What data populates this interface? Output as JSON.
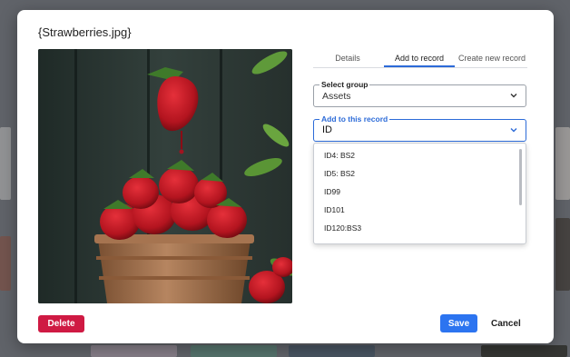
{
  "dialog": {
    "title": "{Strawberries.jpg}",
    "image_alt": "Strawberries in a paper cup"
  },
  "tabs": [
    {
      "label": "Details"
    },
    {
      "label": "Add to record",
      "active": true
    },
    {
      "label": "Create new record"
    }
  ],
  "select_group": {
    "label": "Select group",
    "value": "Assets"
  },
  "add_to_record": {
    "label": "Add to this record",
    "value": "ID"
  },
  "dropdown_options": [
    "ID4: BS2",
    "ID5: BS2",
    "ID99",
    "ID101",
    "ID120:BS3"
  ],
  "buttons": {
    "delete": "Delete",
    "save": "Save",
    "cancel": "Cancel"
  },
  "colors": {
    "accent": "#2c74f0",
    "danger": "#cf1a43",
    "tab_underline": "#2c6bd8"
  }
}
